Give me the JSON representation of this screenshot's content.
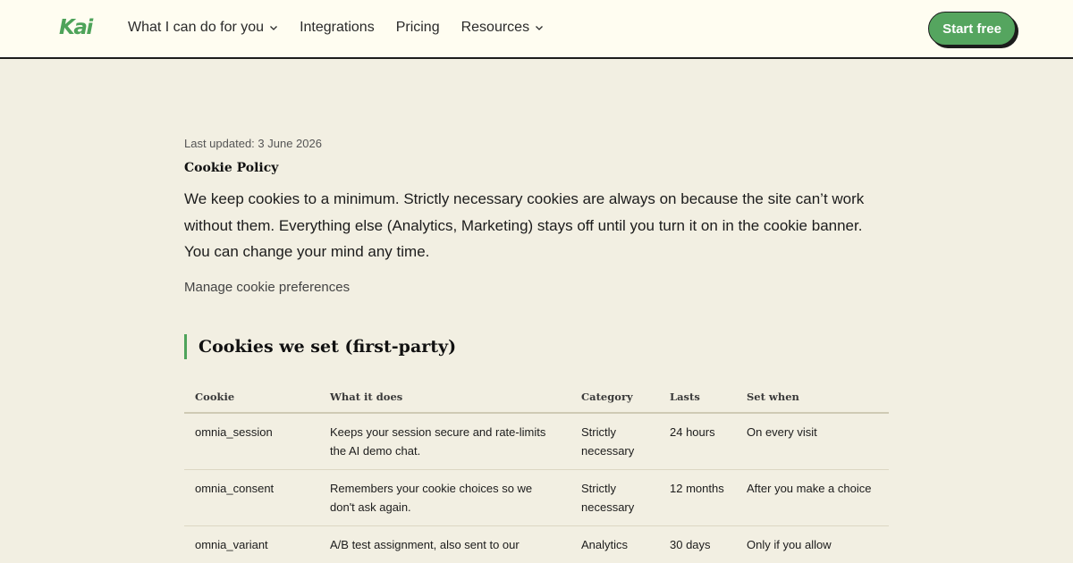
{
  "header": {
    "logo": "Kai",
    "nav": [
      {
        "label": "What I can do for you",
        "dropdown": true
      },
      {
        "label": "Integrations",
        "dropdown": false
      },
      {
        "label": "Pricing",
        "dropdown": false
      },
      {
        "label": "Resources",
        "dropdown": true
      }
    ],
    "cta": "Start free"
  },
  "page": {
    "last_updated": "Last updated: 3 June 2026",
    "title": "Cookie Policy",
    "intro": "We keep cookies to a minimum. Strictly necessary cookies are always on because the site can’t work without them. Everything else (Analytics, Marketing) stays off until you turn it on in the cookie banner. You can change your mind any time.",
    "manage_link": "Manage cookie preferences",
    "section_heading": "Cookies we set (first-party)"
  },
  "table": {
    "headers": [
      "Cookie",
      "What it does",
      "Category",
      "Lasts",
      "Set when"
    ],
    "rows": [
      [
        "omnia_session",
        "Keeps your session secure and rate-limits the AI demo chat.",
        "Strictly necessary",
        "24 hours",
        "On every visit"
      ],
      [
        "omnia_consent",
        "Remembers your cookie choices so we don't ask again.",
        "Strictly necessary",
        "12 months",
        "After you make a choice"
      ],
      [
        "omnia_variant",
        "A/B test assignment, also sent to our",
        "Analytics",
        "30 days",
        "Only if you allow"
      ]
    ]
  },
  "colors": {
    "accent": "#4ea35a",
    "background": "#f2efe2",
    "header_background": "#fffdf1"
  }
}
